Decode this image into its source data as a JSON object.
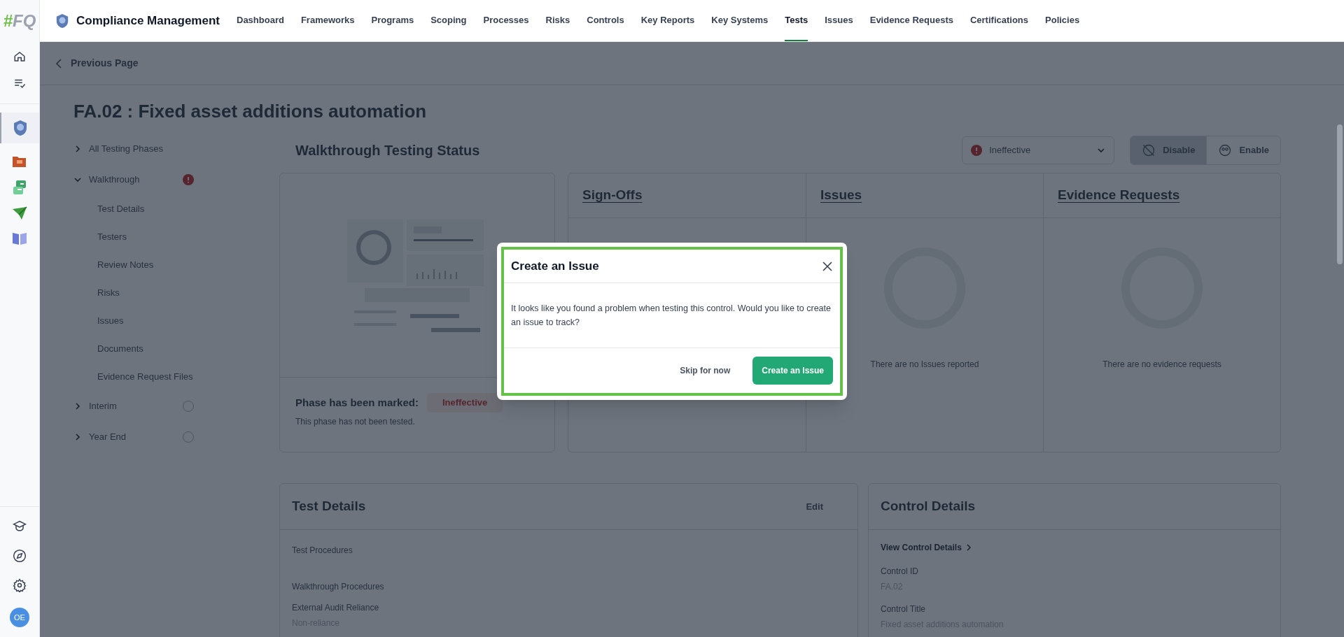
{
  "app": {
    "logo_mark": "#",
    "logo_text": "FQ",
    "title": "Compliance Management",
    "user_initials": "OE"
  },
  "nav": [
    {
      "label": "Dashboard",
      "selected": false
    },
    {
      "label": "Frameworks",
      "selected": false
    },
    {
      "label": "Programs",
      "selected": false
    },
    {
      "label": "Scoping",
      "selected": false
    },
    {
      "label": "Processes",
      "selected": false
    },
    {
      "label": "Risks",
      "selected": false
    },
    {
      "label": "Controls",
      "selected": false
    },
    {
      "label": "Key Reports",
      "selected": false
    },
    {
      "label": "Key Systems",
      "selected": false
    },
    {
      "label": "Tests",
      "selected": true
    },
    {
      "label": "Issues",
      "selected": false
    },
    {
      "label": "Evidence Requests",
      "selected": false
    },
    {
      "label": "Certifications",
      "selected": false
    },
    {
      "label": "Policies",
      "selected": false
    }
  ],
  "back_link": "Previous Page",
  "page_title": "FA.02 : Fixed asset additions automation",
  "phases": [
    {
      "label": "All Testing Phases",
      "expanded": false,
      "kind": "summary"
    },
    {
      "label": "Walkthrough",
      "expanded": true,
      "kind": "phase",
      "error": true,
      "children": [
        {
          "label": "Test Details"
        },
        {
          "label": "Testers"
        },
        {
          "label": "Review Notes"
        },
        {
          "label": "Risks"
        },
        {
          "label": "Issues"
        },
        {
          "label": "Documents"
        },
        {
          "label": "Evidence Request Files"
        }
      ]
    },
    {
      "label": "Interim",
      "expanded": false,
      "kind": "phase",
      "error": false
    },
    {
      "label": "Year End",
      "expanded": false,
      "kind": "phase",
      "error": false
    }
  ],
  "status_section": {
    "title": "Walkthrough Testing Status",
    "status_select": {
      "value": "Ineffective"
    },
    "toggles": [
      {
        "label": "Disable",
        "selected": true
      },
      {
        "label": "Enable",
        "selected": false
      }
    ],
    "marked_label": "Phase has been marked:",
    "marked_badge": "Ineffective",
    "marked_note": "This phase has not been tested.",
    "panels": [
      {
        "title": "Sign-Offs"
      },
      {
        "title": "Issues",
        "empty_text": "There are no Issues reported"
      },
      {
        "title": "Evidence Requests",
        "empty_text": "There are no evidence requests"
      }
    ]
  },
  "test_details": {
    "title": "Test Details",
    "edit": "Edit",
    "fields": [
      {
        "label": "Test Procedures"
      },
      {
        "label": "Walkthrough Procedures"
      },
      {
        "label": "External Audit Reliance",
        "value": "Non-reliance"
      }
    ]
  },
  "control_details": {
    "title": "Control Details",
    "link": "View Control Details",
    "fields": [
      {
        "label": "Control ID",
        "value": "FA.02"
      },
      {
        "label": "Control Title",
        "value": "Fixed asset additions automation"
      }
    ]
  },
  "modal": {
    "title": "Create an Issue",
    "body": "It looks like you found a problem when testing this control. Would you like to create an issue to track?",
    "buttons": [
      {
        "label": "Skip for now",
        "kind": "secondary"
      },
      {
        "label": "Create an Issue",
        "kind": "primary"
      }
    ]
  }
}
